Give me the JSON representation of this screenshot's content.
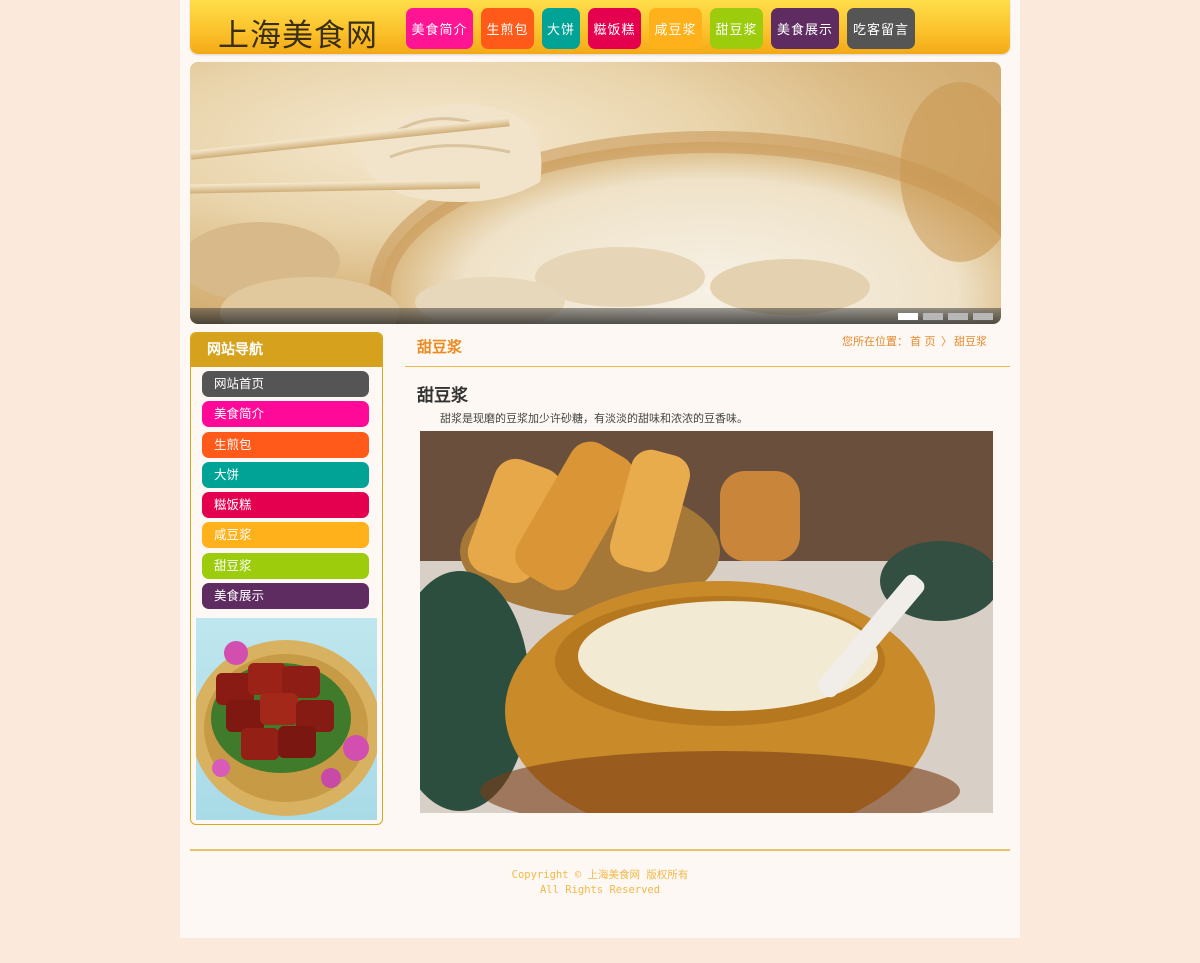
{
  "header": {
    "logo": "上海美食网",
    "nav": [
      {
        "label": "美食简介",
        "color": "#ff1493"
      },
      {
        "label": "生煎包",
        "color": "#ff5a1a"
      },
      {
        "label": "大饼",
        "color": "#00a396"
      },
      {
        "label": "糍饭糕",
        "color": "#e5004f"
      },
      {
        "label": "咸豆浆",
        "color": "#ffb11b"
      },
      {
        "label": "甜豆浆",
        "color": "#9ccc0b"
      },
      {
        "label": "美食展示",
        "color": "#5f2c61"
      },
      {
        "label": "吃客留言",
        "color": "#555555"
      }
    ]
  },
  "banner": {
    "image": "soup-dumplings-photo",
    "slide_count": 4,
    "active_slide": 1
  },
  "sidebar": {
    "title": "网站导航",
    "items": [
      {
        "label": "网站首页",
        "color": "#555555"
      },
      {
        "label": "美食简介",
        "color": "#ff0a98"
      },
      {
        "label": "生煎包",
        "color": "#ff5a1a"
      },
      {
        "label": "大饼",
        "color": "#00a396"
      },
      {
        "label": "糍饭糕",
        "color": "#e5004f"
      },
      {
        "label": "咸豆浆",
        "color": "#ffb11b"
      },
      {
        "label": "甜豆浆",
        "color": "#9ccc0b"
      },
      {
        "label": "美食展示",
        "color": "#5f2c61"
      }
    ],
    "image": "braised-pork-photo"
  },
  "content": {
    "section_title": "甜豆浆",
    "breadcrumb": {
      "prefix": "您所在位置：",
      "home": "首 页",
      "separator": "〉",
      "current": "甜豆浆"
    },
    "article_title": "甜豆浆",
    "article_text": "甜浆是现磨的豆浆加少许砂糖，有淡淡的甜味和浓浓的豆香味。",
    "image": "sweet-soy-milk-photo"
  },
  "footer": {
    "copyright": "Copyright © 上海美食网 版权所有",
    "rights": "All Rights Reserved"
  },
  "colors": {
    "accent": "#ec8b22",
    "header_gold": "#fbc12a",
    "page_bg": "#fbeadb"
  }
}
